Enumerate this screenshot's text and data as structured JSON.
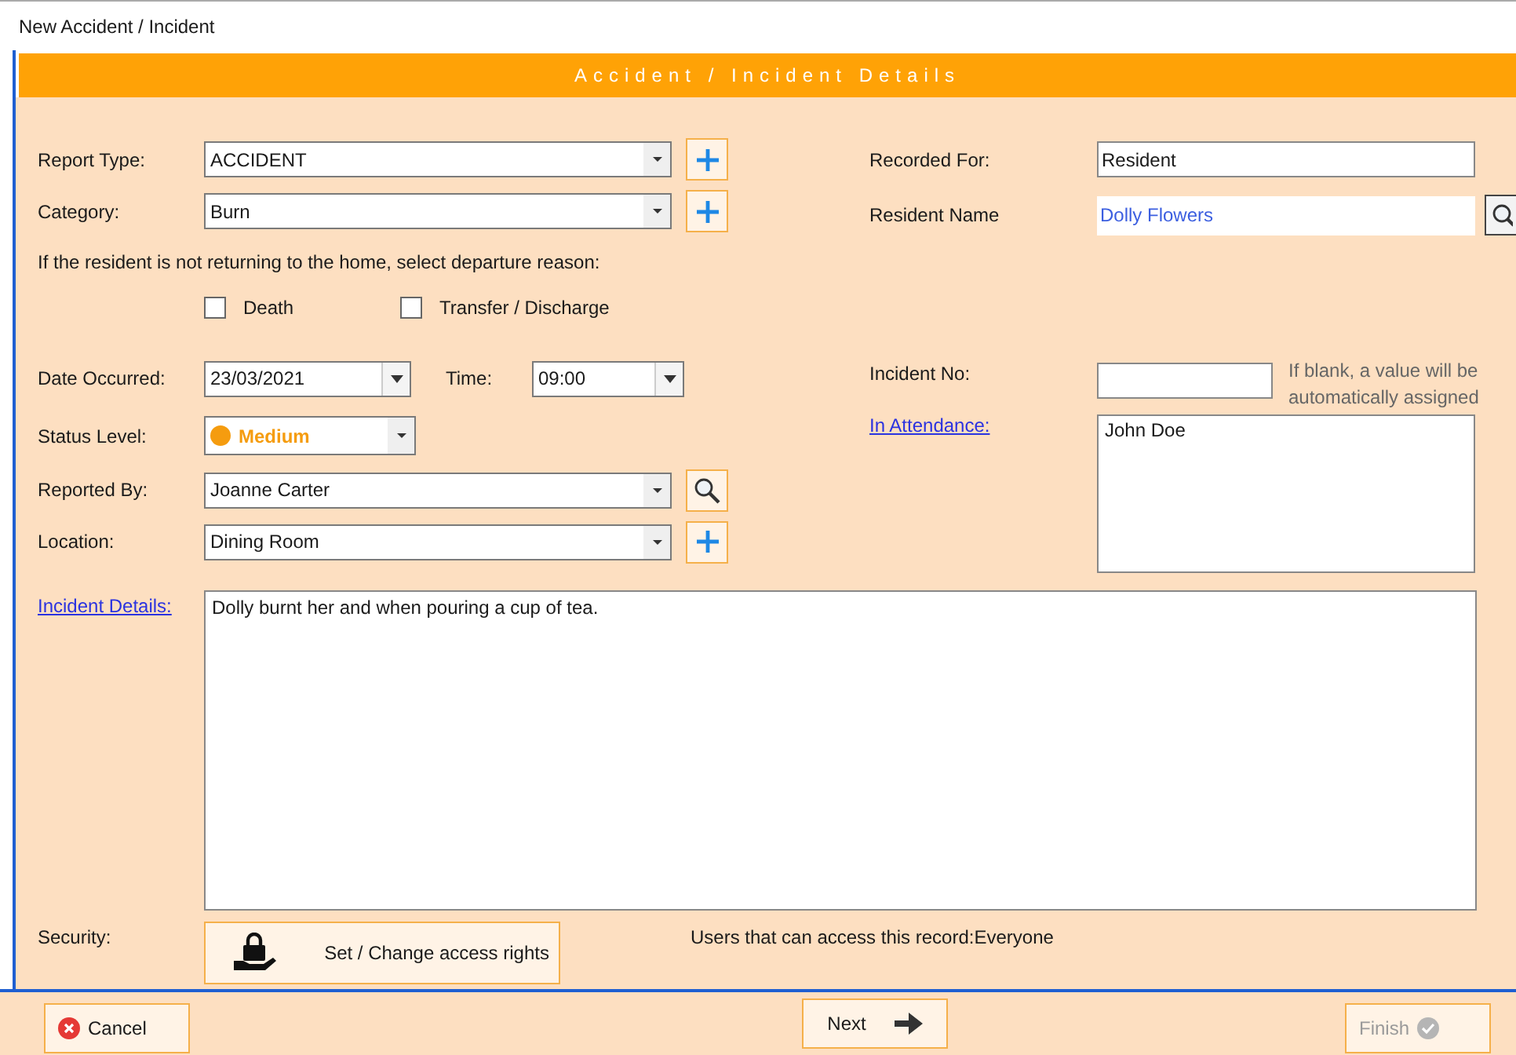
{
  "window": {
    "title": "New Accident / Incident"
  },
  "header": {
    "title": "Accident / Incident Details"
  },
  "left_fields": [
    {
      "label": "Report Type:",
      "value": "ACCIDENT",
      "kind": "add"
    },
    {
      "label": "Category:",
      "value": "Burn",
      "kind": "add"
    }
  ],
  "departure": {
    "prompt": "If the resident is not returning to the home, select departure reason:",
    "options": [
      {
        "label": "Death",
        "checked": false
      },
      {
        "label": "Transfer / Discharge",
        "checked": false
      }
    ]
  },
  "date_occurred": {
    "label": "Date Occurred:",
    "value": "23/03/2021"
  },
  "time": {
    "label": "Time:",
    "value": "09:00"
  },
  "status_level": {
    "label": "Status Level:",
    "value": "Medium"
  },
  "lower_fields": [
    {
      "label": "Reported By:",
      "value": "Joanne Carter",
      "kind": "search"
    },
    {
      "label": "Location:",
      "value": "Dining Room",
      "kind": "add"
    }
  ],
  "recorded_for": {
    "label": "Recorded For:",
    "value": "Resident"
  },
  "resident_name": {
    "label": "Resident Name",
    "value": "Dolly Flowers"
  },
  "incident_no": {
    "label": "Incident No:",
    "hint": "If blank, a value will be automatically assigned"
  },
  "in_attendance": {
    "label": "In Attendance:",
    "value": "John Doe"
  },
  "incident_details": {
    "label": "Incident Details:",
    "value": "Dolly burnt her and when pouring a cup of tea."
  },
  "security": {
    "label": "Security:",
    "button": "Set / Change access rights",
    "access_text": "Users that can access this record:Everyone"
  },
  "footer": [
    {
      "label": "Cancel",
      "kind": "cancel",
      "disabled": false
    },
    {
      "label": "Next",
      "kind": "next",
      "disabled": false
    },
    {
      "label": "Finish",
      "kind": "finish",
      "disabled": true
    }
  ]
}
